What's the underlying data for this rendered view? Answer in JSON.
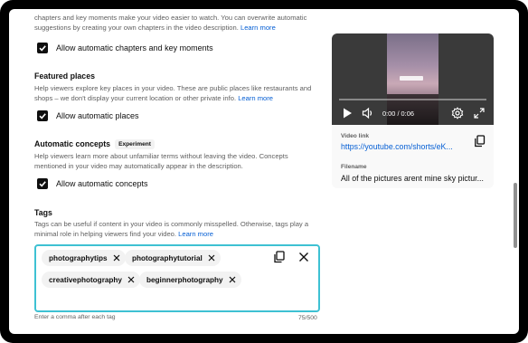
{
  "chapters": {
    "desc_line1": "chapters and key moments make your video easier to watch. You can overwrite automatic",
    "desc_line2": "suggestions by creating your own chapters in the video description.",
    "learn_more": "Learn more",
    "checkbox_label": "Allow automatic chapters and key moments"
  },
  "featured_places": {
    "title": "Featured places",
    "desc_line1": "Help viewers explore key places in your video. These are public places like restaurants and",
    "desc_line2": "shops – we don't display your current location or other private info.",
    "learn_more": "Learn more",
    "checkbox_label": "Allow automatic places"
  },
  "automatic_concepts": {
    "title": "Automatic concepts",
    "badge": "Experiment",
    "desc_line1": "Help viewers learn more about unfamiliar terms without leaving the video. Concepts",
    "desc_line2": "mentioned in your video may automatically appear in the description.",
    "checkbox_label": "Allow automatic concepts"
  },
  "tags": {
    "title": "Tags",
    "desc_line1": "Tags can be useful if content in your video is commonly misspelled. Otherwise, tags play a",
    "desc_line2": "minimal role in helping viewers find your video.",
    "learn_more": "Learn more",
    "items": [
      "photographytips",
      "photographytutorial",
      "creativephotography",
      "beginnerphotography"
    ],
    "hint": "Enter a comma after each tag",
    "count": "75/500"
  },
  "video": {
    "time": "0:00 / 0:06",
    "progress": 0,
    "video_link_label": "Video link",
    "video_link": "https://youtube.com/shorts/eK...",
    "filename_label": "Filename",
    "filename": "All of the pictures arent mine sky pictur..."
  },
  "colors": {
    "accent": "#065fd4",
    "focus": "#3ec1d3"
  }
}
